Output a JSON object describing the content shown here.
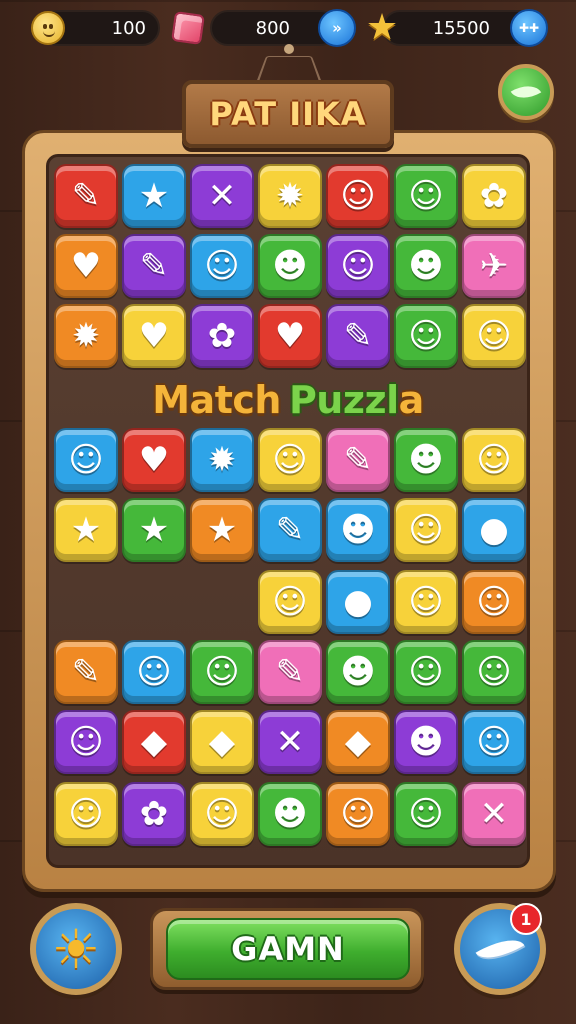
{
  "hud": {
    "coins": "100",
    "gems": "800",
    "stars": "15500",
    "gems_plus_icon": "plus-icon",
    "stars_plus_icon": "plus-icon"
  },
  "title": "PAT IIKA",
  "match_label": {
    "w1": "Match",
    "w2": "Puzzl",
    "w3": "a"
  },
  "play_button": "GAMN",
  "notification_count": "1",
  "colors": {
    "red": "#e23a2e",
    "yellow": "#f7d23a",
    "purple": "#8d3cd6",
    "blue": "#2ea4e8",
    "green": "#45b83a",
    "orange": "#f08a24",
    "pink": "#f06fb8"
  },
  "board": {
    "rows": [
      [
        {
          "c": "red",
          "i": "✎"
        },
        {
          "c": "blue",
          "i": "★"
        },
        {
          "c": "purple",
          "i": "✕"
        },
        {
          "c": "yellow",
          "i": "✹"
        },
        {
          "c": "red",
          "i": "☺"
        },
        {
          "c": "green",
          "i": "☺"
        },
        {
          "c": "yellow",
          "i": "✿"
        }
      ],
      [
        {
          "c": "orange",
          "i": "♥"
        },
        {
          "c": "purple",
          "i": "✎"
        },
        {
          "c": "blue",
          "i": "☺"
        },
        {
          "c": "green",
          "i": "☻"
        },
        {
          "c": "purple",
          "i": "☺"
        },
        {
          "c": "green",
          "i": "☻"
        },
        {
          "c": "pink",
          "i": "✈"
        }
      ],
      [
        {
          "c": "orange",
          "i": "✹"
        },
        {
          "c": "yellow",
          "i": "♥"
        },
        {
          "c": "purple",
          "i": "✿"
        },
        {
          "c": "red",
          "i": "♥"
        },
        {
          "c": "purple",
          "i": "✎"
        },
        {
          "c": "green",
          "i": "☺"
        },
        {
          "c": "yellow",
          "i": "☺"
        }
      ],
      [
        {
          "c": "blue",
          "i": "☺"
        },
        {
          "c": "red",
          "i": "♥"
        },
        {
          "c": "blue",
          "i": "✹"
        },
        {
          "c": "yellow",
          "i": "☺"
        },
        {
          "c": "pink",
          "i": "✎"
        },
        {
          "c": "green",
          "i": "☻"
        },
        {
          "c": "yellow",
          "i": "☺"
        }
      ],
      [
        {
          "c": "yellow",
          "i": "★"
        },
        {
          "c": "green",
          "i": "★"
        },
        {
          "c": "orange",
          "i": "★"
        },
        {
          "c": "blue",
          "i": "✎"
        },
        {
          "c": "blue",
          "i": "☻"
        },
        {
          "c": "yellow",
          "i": "☺"
        },
        {
          "c": "blue",
          "i": "●"
        }
      ],
      [
        null,
        null,
        null,
        {
          "c": "yellow",
          "i": "☺"
        },
        {
          "c": "blue",
          "i": "●"
        },
        {
          "c": "yellow",
          "i": "☺"
        },
        {
          "c": "orange",
          "i": "☺"
        }
      ],
      [
        {
          "c": "orange",
          "i": "✎"
        },
        {
          "c": "blue",
          "i": "☺"
        },
        {
          "c": "green",
          "i": "☺"
        },
        {
          "c": "pink",
          "i": "✎"
        },
        {
          "c": "green",
          "i": "☻"
        },
        {
          "c": "green",
          "i": "☺"
        },
        {
          "c": "green",
          "i": "☺"
        }
      ],
      [
        {
          "c": "purple",
          "i": "☺"
        },
        {
          "c": "red",
          "i": "◆"
        },
        {
          "c": "yellow",
          "i": "◆"
        },
        {
          "c": "purple",
          "i": "✕"
        },
        {
          "c": "orange",
          "i": "◆"
        },
        {
          "c": "purple",
          "i": "☻"
        },
        {
          "c": "blue",
          "i": "☺"
        }
      ],
      [
        {
          "c": "yellow",
          "i": "☺"
        },
        {
          "c": "purple",
          "i": "✿"
        },
        {
          "c": "yellow",
          "i": "☺"
        },
        {
          "c": "green",
          "i": "☻"
        },
        {
          "c": "orange",
          "i": "☺"
        },
        {
          "c": "green",
          "i": "☺"
        },
        {
          "c": "pink",
          "i": "✕"
        }
      ]
    ]
  }
}
